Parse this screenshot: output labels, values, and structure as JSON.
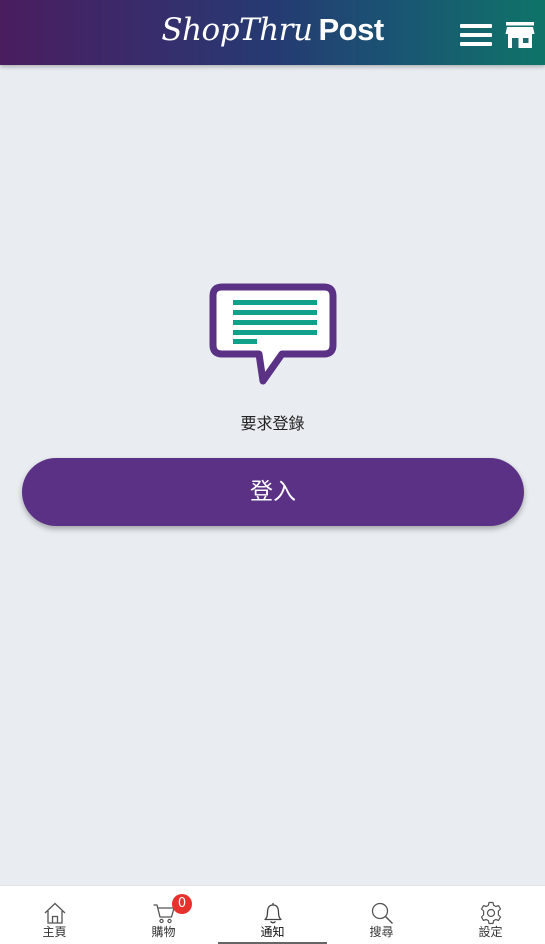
{
  "header": {
    "logo_script": "ShopThru",
    "logo_bold": "Post",
    "menu_icon": "hamburger-menu-icon",
    "store_icon": "store-icon"
  },
  "colors": {
    "header_gradient_start": "#4a1d5f",
    "header_gradient_end": "#0e7468",
    "accent_purple": "#5b3186",
    "accent_teal": "#13a08a",
    "badge_red": "#e8302c",
    "background": "#e9edf1"
  },
  "main": {
    "icon": "message-bubble-icon",
    "message": "要求登錄",
    "login_label": "登入"
  },
  "tabbar": {
    "active": "通知",
    "tabs": [
      {
        "label": "主頁",
        "icon": "home-icon"
      },
      {
        "label": "購物",
        "icon": "cart-icon",
        "badge": "0"
      },
      {
        "label": "通知",
        "icon": "bell-icon"
      },
      {
        "label": "搜尋",
        "icon": "search-icon"
      },
      {
        "label": "設定",
        "icon": "settings-icon"
      }
    ]
  }
}
